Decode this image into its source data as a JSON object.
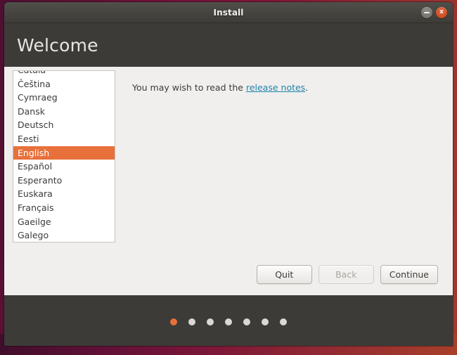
{
  "window": {
    "title": "Install",
    "controls": {
      "minimize_label": "",
      "close_label": "x"
    }
  },
  "page": {
    "heading": "Welcome"
  },
  "language_list": {
    "items": [
      {
        "label": "Català",
        "selected": false
      },
      {
        "label": "Čeština",
        "selected": false
      },
      {
        "label": "Cymraeg",
        "selected": false
      },
      {
        "label": "Dansk",
        "selected": false
      },
      {
        "label": "Deutsch",
        "selected": false
      },
      {
        "label": "Eesti",
        "selected": false
      },
      {
        "label": "English",
        "selected": true
      },
      {
        "label": "Español",
        "selected": false
      },
      {
        "label": "Esperanto",
        "selected": false
      },
      {
        "label": "Euskara",
        "selected": false
      },
      {
        "label": "Français",
        "selected": false
      },
      {
        "label": "Gaeilge",
        "selected": false
      },
      {
        "label": "Galego",
        "selected": false
      }
    ],
    "selected_value": "English"
  },
  "note": {
    "prefix": "You may wish to read the ",
    "link_label": "release notes",
    "suffix": "."
  },
  "actions": {
    "quit_label": "Quit",
    "back_label": "Back",
    "back_disabled": true,
    "continue_label": "Continue"
  },
  "progress": {
    "total_steps": 7,
    "current_step": 1
  },
  "colors": {
    "accent_orange": "#e8703a",
    "chrome_dark": "#3c3b37",
    "content_bg": "#f0efee",
    "link_blue": "#1f82a8"
  }
}
